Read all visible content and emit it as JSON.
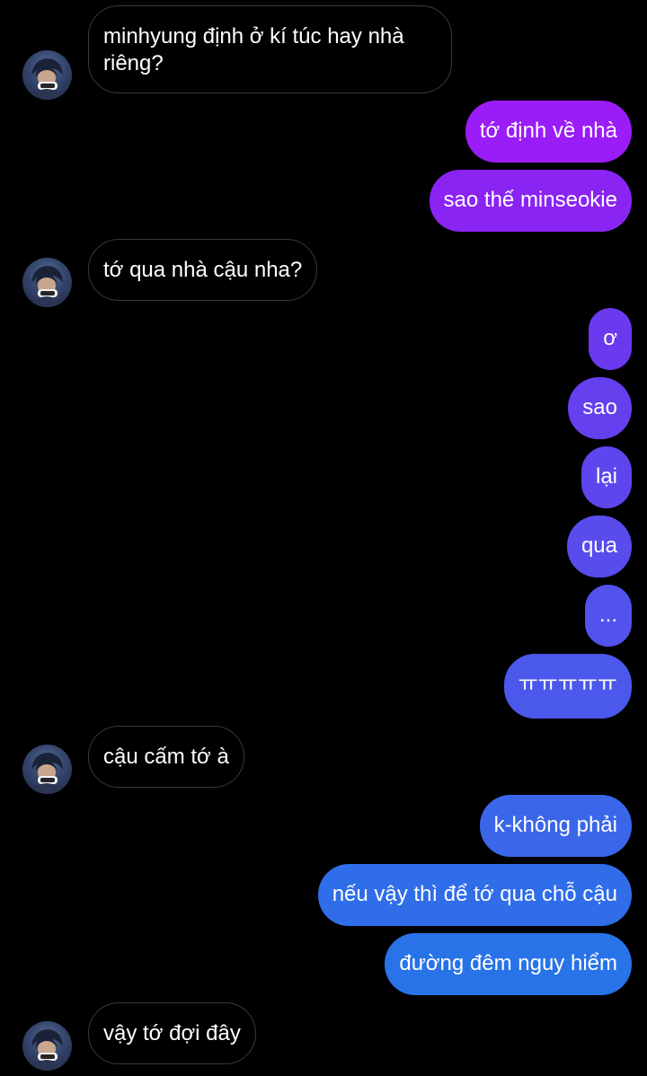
{
  "conversation": {
    "messages": [
      {
        "side": "in",
        "text": "minhyung định ở kí túc hay nhà riêng?"
      },
      {
        "side": "out",
        "text": "tớ định về nhà",
        "color": "#9a1cf7"
      },
      {
        "side": "out",
        "text": "sao thế minseokie",
        "color": "#8a24f2"
      },
      {
        "side": "in",
        "text": "tớ qua nhà cậu nha?"
      },
      {
        "side": "out",
        "text": "ơ",
        "color": "#6b3aef"
      },
      {
        "side": "out",
        "text": "sao",
        "color": "#6440ee"
      },
      {
        "side": "out",
        "text": "lại",
        "color": "#5d46ed"
      },
      {
        "side": "out",
        "text": "qua",
        "color": "#584ced"
      },
      {
        "side": "out",
        "text": "...",
        "color": "#5252ed"
      },
      {
        "side": "out",
        "text": "ㅠㅠㅠㅠㅠ",
        "color": "#4a58ec"
      },
      {
        "side": "in",
        "text": "cậu cấm tớ à"
      },
      {
        "side": "out",
        "text": "k-không phải",
        "color": "#3a66ea"
      },
      {
        "side": "out",
        "text": "nếu vậy thì để tớ qua chỗ cậu",
        "color": "#2f6de9"
      },
      {
        "side": "out",
        "text": "đường đêm nguy hiểm",
        "color": "#2873e8"
      },
      {
        "side": "in",
        "text": "vậy tớ đợi đây"
      }
    ]
  },
  "avatar": {
    "icon": "user-avatar-icon"
  }
}
